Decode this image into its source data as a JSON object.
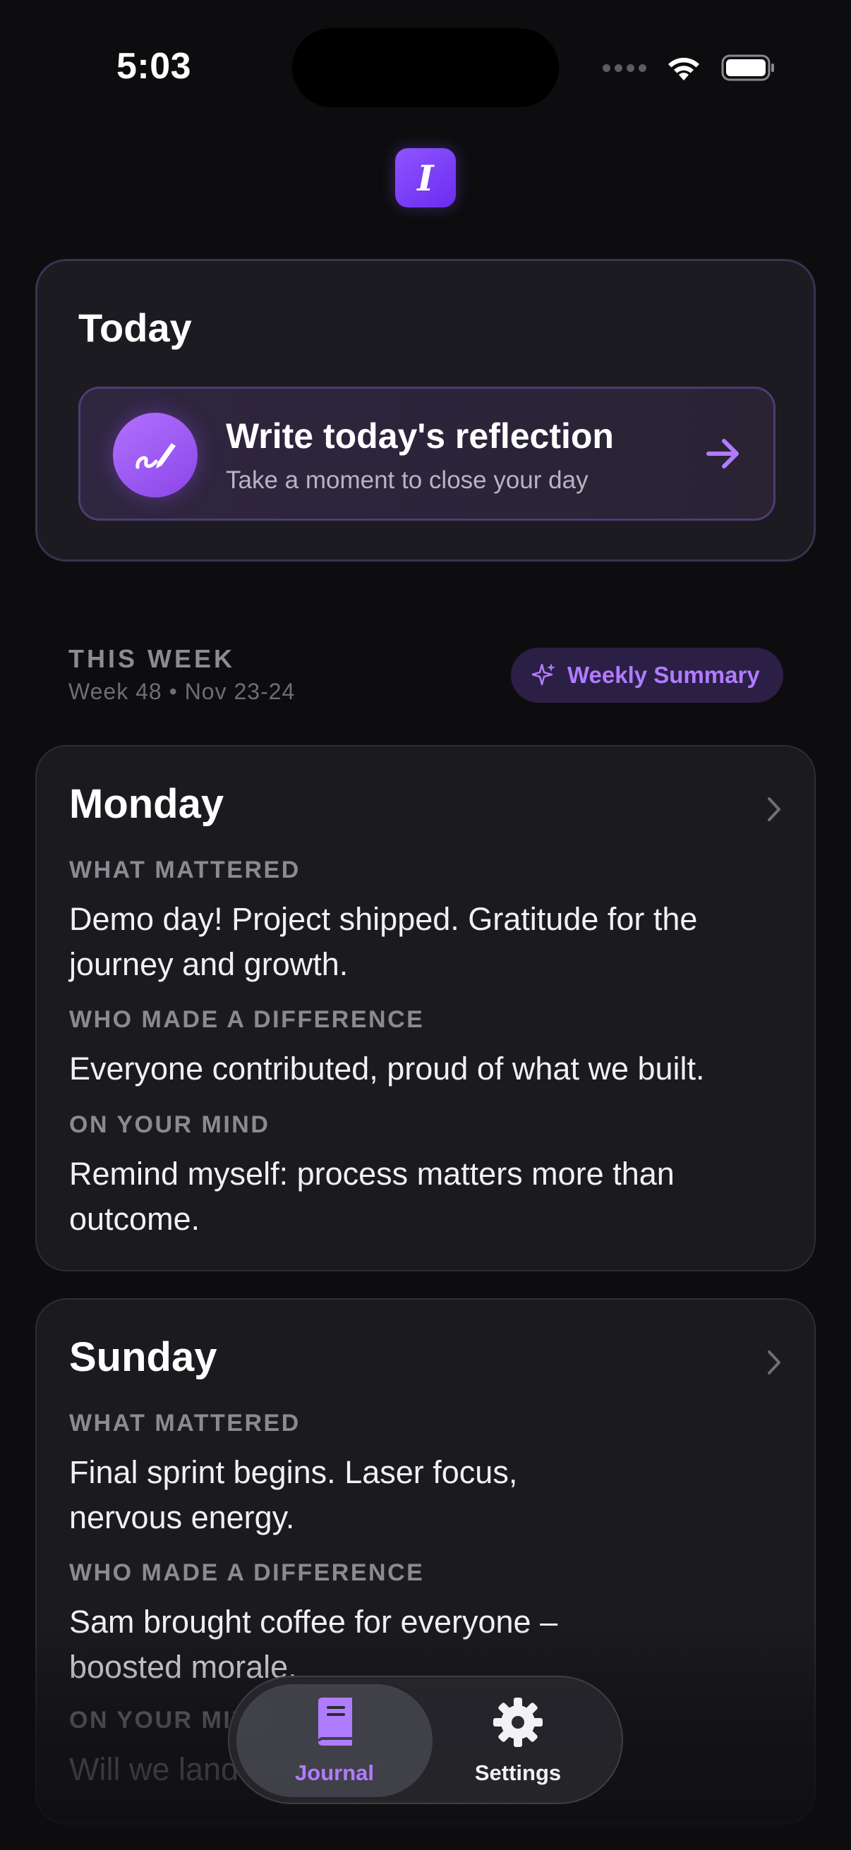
{
  "status_bar": {
    "time": "5:03"
  },
  "app": {
    "logo_letter": "I"
  },
  "today": {
    "title": "Today",
    "reflection_title": "Write today's reflection",
    "reflection_subtitle": "Take a moment to close your day"
  },
  "week": {
    "label": "THIS WEEK",
    "range": "Week 48 • Nov 23-24",
    "summary_button": "Weekly Summary"
  },
  "days": [
    {
      "name": "Monday",
      "sections": [
        {
          "label": "WHAT MATTERED",
          "text": "Demo day! Project shipped. Gratitude for the journey and growth."
        },
        {
          "label": "WHO MADE A DIFFERENCE",
          "text": "Everyone contributed, proud of what we built."
        },
        {
          "label": "ON YOUR MIND",
          "text": "Remind myself: process matters more than outcome."
        }
      ]
    },
    {
      "name": "Sunday",
      "sections": [
        {
          "label": "WHAT MATTERED",
          "text": "Final sprint begins. Laser focus, nervous energy."
        },
        {
          "label": "WHO MADE A DIFFERENCE",
          "text": "Sam brought coffee for everyone – boosted morale."
        },
        {
          "label": "ON YOUR MIND",
          "text": "Will we land it in time?"
        }
      ]
    }
  ],
  "tabs": [
    {
      "label": "Journal",
      "icon": "book-icon",
      "active": true
    },
    {
      "label": "Settings",
      "icon": "gear-icon",
      "active": false
    }
  ],
  "colors": {
    "accent": "#b07cff",
    "background": "#0d0d0f",
    "card": "#1b1b1f"
  }
}
